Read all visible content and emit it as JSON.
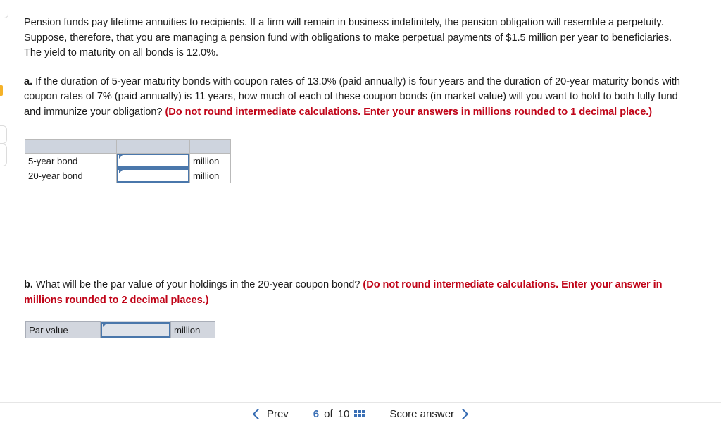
{
  "question": {
    "intro": "Pension funds pay lifetime annuities to recipients. If a firm will remain in business indefinitely, the pension obligation will resemble a perpetuity. Suppose, therefore, that you are managing a pension fund with obligations to make perpetual payments of $1.5 million per year to beneficiaries. The yield to maturity on all bonds is 12.0%.",
    "part_a": {
      "label": "a.",
      "text": " If the duration of 5-year maturity bonds with coupon rates of 13.0% (paid annually) is four years and the duration of 20-year maturity bonds with coupon rates of 7% (paid annually) is 11 years, how much of each of these coupon bonds (in market value) will you want to hold to both fully fund and immunize your obligation? ",
      "note": "(Do not round intermediate calculations. Enter your answers in millions rounded to 1 decimal place.)"
    },
    "part_b": {
      "label": "b.",
      "text": " What will be the par value of your holdings in the 20-year coupon bond? ",
      "note": "(Do not round intermediate calculations. Enter your answers in millions rounded to 2 decimal places.)",
      "note_display": "(Do not round intermediate calculations. Enter your answer in millions rounded to 2 decimal places.)"
    }
  },
  "table_a": {
    "header": [
      "",
      "",
      ""
    ],
    "rows": [
      {
        "label": "5-year bond",
        "value": "",
        "unit": "million"
      },
      {
        "label": "20-year bond",
        "value": "",
        "unit": "million"
      }
    ]
  },
  "table_b": {
    "rows": [
      {
        "label": "Par value",
        "value": "",
        "unit": "million"
      }
    ]
  },
  "footer": {
    "prev_label": "Prev",
    "page_current": "6",
    "page_of": "of",
    "page_total": "10",
    "grid_icon": "grid-icon",
    "score_label": "Score answer"
  },
  "colors": {
    "note_red": "#c00418",
    "accent_blue": "#3a6fb5",
    "input_border": "#4a77ab",
    "table_header_fill": "#ced4de",
    "table_b_fill": "#d2d6de",
    "edge_marker": "#f5b228"
  }
}
